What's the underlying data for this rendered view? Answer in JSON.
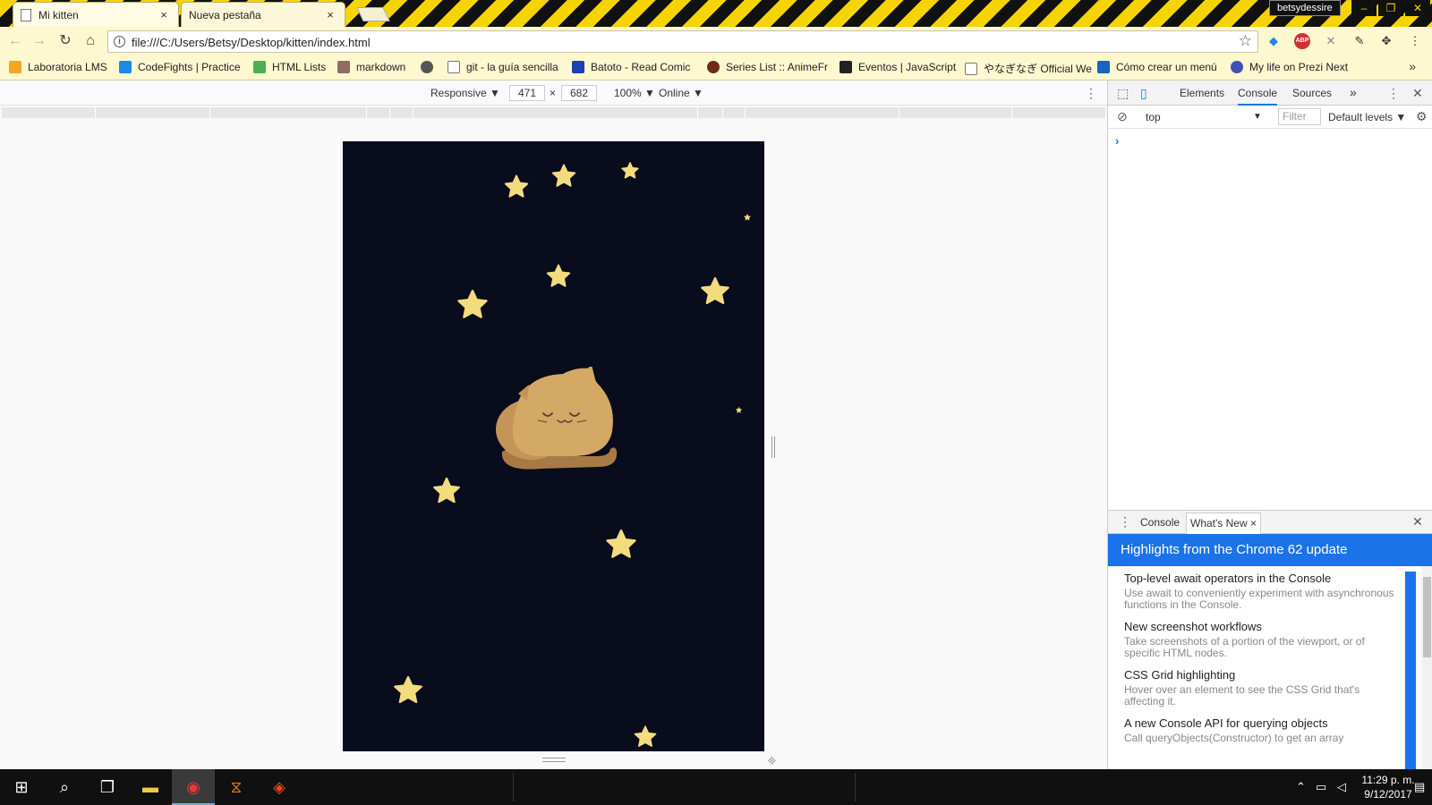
{
  "browser": {
    "tabs": [
      {
        "label": "Mi kitten",
        "close": "×"
      },
      {
        "label": "Nueva pestaña",
        "close": "×"
      }
    ],
    "profile_name": "betsydessire",
    "window_controls": [
      "–",
      "❐",
      "✕"
    ],
    "url": "file:///C:/Users/Betsy/Desktop/kitten/index.html"
  },
  "bookmarks": [
    {
      "label": "Laboratoria LMS",
      "icon": "laboratoria-icon",
      "color": "#f5a623"
    },
    {
      "label": "CodeFights | Practice",
      "icon": "codefights-icon",
      "color": "#1e88e5"
    },
    {
      "label": "HTML Lists",
      "icon": "w3schools-icon",
      "color": "#4caf50"
    },
    {
      "label": "markdown",
      "icon": "markdown-icon",
      "color": "#8d6e63"
    },
    {
      "label": "",
      "icon": "globe-icon",
      "color": "#555555"
    },
    {
      "label": "git - la guía sencilla",
      "icon": "page-icon",
      "color": "#ffffff"
    },
    {
      "label": "Batoto - Read Comic",
      "icon": "batoto-icon",
      "color": "#1e40af"
    },
    {
      "label": "Series List :: AnimeFr",
      "icon": "anime-icon",
      "color": "#6d2c1a"
    },
    {
      "label": "Eventos | JavaScript",
      "icon": "js-icon",
      "color": "#222222"
    },
    {
      "label": "やなぎなぎ Official We",
      "icon": "page-icon",
      "color": "#ffffff"
    },
    {
      "label": "Cómo crear un menú",
      "icon": "blog-icon",
      "color": "#1565c0"
    },
    {
      "label": "My life on Prezi Next",
      "icon": "prezi-icon",
      "color": "#3f51b5"
    }
  ],
  "device_toolbar": {
    "device": "Responsive ▼",
    "width": "471",
    "times": "×",
    "height": "682",
    "zoom": "100% ▼",
    "throttle": "Online ▼"
  },
  "devtools": {
    "tabs": [
      "Elements",
      "Console",
      "Sources"
    ],
    "active_tab": "Console",
    "more": "»",
    "context": "top",
    "filter_placeholder": "Filter",
    "levels": "Default levels ▼",
    "prompt": "›",
    "drawer_tabs": [
      "Console",
      "What's New"
    ],
    "drawer_close": "×",
    "whats_new_title": "Highlights from the Chrome 62 update",
    "whats_new_items": [
      {
        "title": "Top-level await operators in the Console",
        "desc": "Use await to conveniently experiment with asynchronous functions in the Console."
      },
      {
        "title": "New screenshot workflows",
        "desc": "Take screenshots of a portion of the viewport, or of specific HTML nodes."
      },
      {
        "title": "CSS Grid highlighting",
        "desc": "Hover over an element to see the CSS Grid that's affecting it."
      },
      {
        "title": "A new Console API for querying objects",
        "desc": "Call queryObjects(Constructor) to get an array"
      }
    ]
  },
  "taskbar": {
    "time": "11:29 p. m.",
    "date": "9/12/2017"
  },
  "colors": {
    "night_sky": "#080c1c",
    "star": "#f3dc7d",
    "cat_body": "#d4a966",
    "cat_tail": "#a87a45",
    "accent": "#1a73e8"
  }
}
